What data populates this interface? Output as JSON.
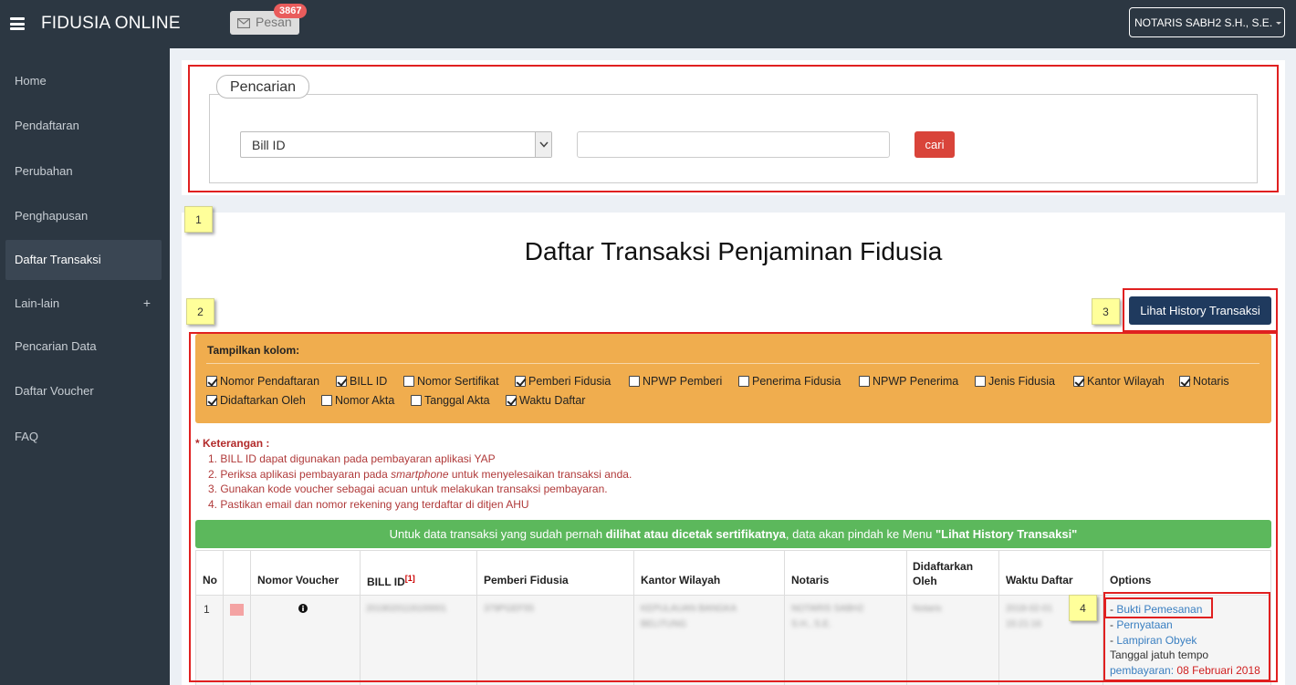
{
  "navbar": {
    "brand": "FIDUSIA ONLINE",
    "pesan_label": "Pesan",
    "pesan_count": "3867",
    "user": "NOTARIS SABH2 S.H., S.E."
  },
  "sidebar": {
    "items": [
      {
        "label": "Home"
      },
      {
        "label": "Pendaftaran"
      },
      {
        "label": "Perubahan"
      },
      {
        "label": "Penghapusan"
      },
      {
        "label": "Daftar Transaksi"
      },
      {
        "label": "Lain-lain",
        "expand": "+"
      },
      {
        "label": "Pencarian Data"
      },
      {
        "label": "Daftar Voucher"
      },
      {
        "label": "FAQ"
      }
    ],
    "active_index": 4
  },
  "search": {
    "legend": "Pencarian",
    "select_value": "Bill ID",
    "input_value": "",
    "button": "cari"
  },
  "annotations": [
    "1",
    "2",
    "3",
    "4"
  ],
  "page_title": "Daftar Transaksi Penjaminan Fidusia",
  "history_button": "Lihat History Transaksi",
  "columns_panel": {
    "label": "Tampilkan kolom:",
    "options": [
      {
        "label": "Nomor Pendaftaran",
        "checked": true
      },
      {
        "label": "BILL ID",
        "checked": true
      },
      {
        "label": "Nomor Sertifikat",
        "checked": false
      },
      {
        "label": "Pemberi Fidusia",
        "checked": true
      },
      {
        "label": "NPWP Pemberi",
        "checked": false
      },
      {
        "label": "Penerima Fidusia",
        "checked": false
      },
      {
        "label": "NPWP Penerima",
        "checked": false
      },
      {
        "label": "Jenis Fidusia",
        "checked": false
      },
      {
        "label": "Kantor Wilayah",
        "checked": true
      },
      {
        "label": "Notaris",
        "checked": true
      },
      {
        "label": "Didaftarkan Oleh",
        "checked": true
      },
      {
        "label": "Nomor Akta",
        "checked": false
      },
      {
        "label": "Tanggal Akta",
        "checked": false
      },
      {
        "label": "Waktu Daftar",
        "checked": true
      }
    ]
  },
  "keterangan": {
    "title": "* Keterangan :",
    "lines": [
      "1. BILL ID dapat digunakan pada pembayaran aplikasi YAP",
      "2. Periksa aplikasi pembayaran pada ",
      "smartphone",
      " untuk menyelesaikan transaksi anda.",
      "3. Gunakan kode voucher sebagai acuan untuk melakukan transaksi pembayaran.",
      "4. Pastikan email dan nomor rekening yang terdaftar di ditjen AHU"
    ]
  },
  "info_bar": {
    "pre": "Untuk data transaksi yang sudah pernah ",
    "bold": "dilihat atau dicetak sertifikatnya",
    "mid": ", data akan pindah ke Menu ",
    "quote": "\"Lihat History Transaksi\""
  },
  "table": {
    "headers": {
      "no": "No",
      "voucher": "Nomor Voucher",
      "bill": "BILL ID",
      "bill_sup": "[1]",
      "pemberi": "Pemberi Fidusia",
      "kanwil": "Kantor Wilayah",
      "notaris": "Notaris",
      "didaftarkan_1": "Didaftarkan",
      "didaftarkan_2": "Oleh",
      "waktu": "Waktu Daftar",
      "options": "Options"
    },
    "row": {
      "no": "1",
      "voucher_icon": "info-icon",
      "bill": "2019020119100001",
      "pemberi": "379PGEF55",
      "kanwil_1": "KEPULAUAN BANGKA",
      "kanwil_2": "BELITUNG",
      "notaris_1": "NOTARIS SABH2",
      "notaris_2": "S.H., S.E.",
      "didaftarkan": "Notaris",
      "waktu_1": "2018-02-01",
      "waktu_2": "15:21:16",
      "options": {
        "bukti": "Bukti Pemesanan",
        "pernyataan": "Pernyataan",
        "lampiran": "Lampiran Obyek",
        "jatuh_1": "Tanggal jatuh tempo",
        "jatuh_2": "pembayaran: ",
        "jatuh_date": "08 Februari 2018"
      }
    }
  },
  "colors": {
    "navbar": "#2c3742",
    "accent_red": "#d9443a",
    "history_btn": "#1f3a5e",
    "orange_panel": "#f0ad4e",
    "green_bar": "#5cb85c",
    "annotation": "#ffff9a",
    "highlight_border": "#e02020"
  }
}
